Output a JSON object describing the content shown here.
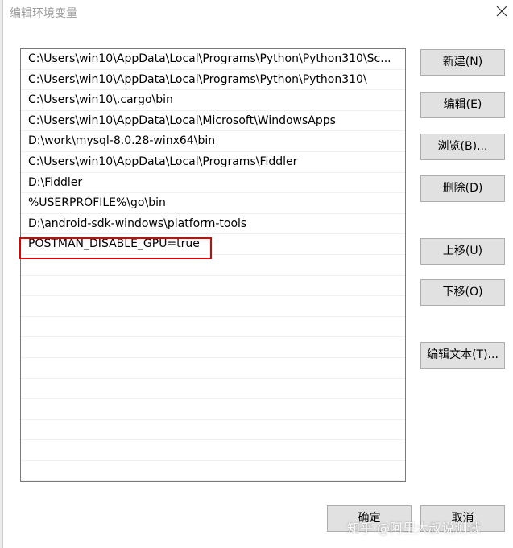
{
  "dialog": {
    "title": "编辑环境变量"
  },
  "path_entries": [
    "C:\\Users\\win10\\AppData\\Local\\Programs\\Python\\Python310\\Sc...",
    "C:\\Users\\win10\\AppData\\Local\\Programs\\Python\\Python310\\",
    "C:\\Users\\win10\\.cargo\\bin",
    "C:\\Users\\win10\\AppData\\Local\\Microsoft\\WindowsApps",
    "D:\\work\\mysql-8.0.28-winx64\\bin",
    "C:\\Users\\win10\\AppData\\Local\\Programs\\Fiddler",
    "D:\\Fiddler",
    "%USERPROFILE%\\go\\bin",
    "D:\\android-sdk-windows\\platform-tools",
    "POSTMAN_DISABLE_GPU=true"
  ],
  "buttons": {
    "new": "新建(N)",
    "edit": "编辑(E)",
    "browse": "浏览(B)...",
    "delete": "删除(D)",
    "move_up": "上移(U)",
    "move_down": "下移(O)",
    "edit_text": "编辑文本(T)...",
    "ok": "确定",
    "cancel": "取消"
  },
  "highlight_color": "#e00000",
  "watermark": "知乎 @阿里大叔说测试"
}
